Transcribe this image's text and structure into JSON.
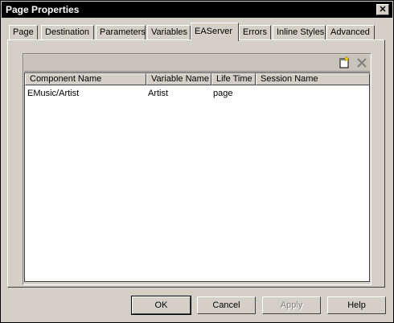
{
  "window": {
    "title": "Page Properties"
  },
  "tabs": [
    {
      "label": "Page",
      "active": false
    },
    {
      "label": "Destination",
      "active": false
    },
    {
      "label": "Parameters",
      "active": false
    },
    {
      "label": "Variables",
      "active": false
    },
    {
      "label": "EAServer",
      "active": true
    },
    {
      "label": "Errors",
      "active": false
    },
    {
      "label": "Inline Styles",
      "active": false
    },
    {
      "label": "Advanced",
      "active": false
    }
  ],
  "toolbar": {
    "icons": [
      "new-item-icon",
      "delete-icon"
    ]
  },
  "table": {
    "columns": [
      "Component Name",
      "Variable Name",
      "Life Time",
      "Session Name"
    ],
    "rows": [
      [
        "EMusic/Artist",
        "Artist",
        "page",
        ""
      ]
    ]
  },
  "buttons": {
    "ok": "OK",
    "cancel": "Cancel",
    "apply": "Apply",
    "help": "Help"
  }
}
